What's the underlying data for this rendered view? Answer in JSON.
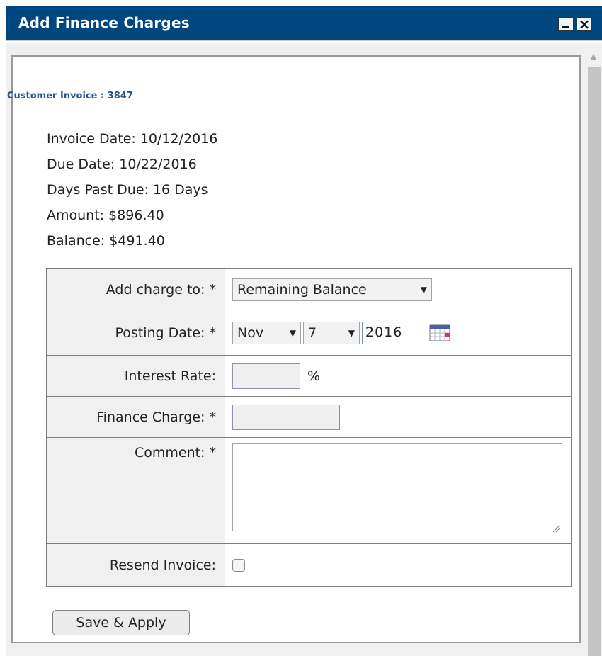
{
  "window": {
    "title": "Add Finance Charges"
  },
  "invoice": {
    "heading": "Customer Invoice : 3847",
    "invoice_date": "Invoice Date: 10/12/2016",
    "due_date": "Due Date: 10/22/2016",
    "days_past_due": "Days Past Due: 16 Days",
    "amount": "Amount: $896.40",
    "balance": "Balance: $491.40"
  },
  "form": {
    "add_charge_label": "Add charge to: *",
    "add_charge_value": "Remaining Balance",
    "posting_date_label": "Posting Date: *",
    "posting_month": "Nov",
    "posting_day": "7",
    "posting_year": "2016",
    "interest_rate_label": "Interest Rate:",
    "interest_rate_value": "",
    "interest_rate_unit": "%",
    "finance_charge_label": "Finance Charge: *",
    "finance_charge_value": "",
    "comment_label": "Comment: *",
    "comment_value": "",
    "resend_label": "Resend Invoice:",
    "resend_checked": false
  },
  "actions": {
    "save_apply_label": "Save & Apply"
  },
  "colors": {
    "titlebar": "#00477f",
    "heading": "#2a5589"
  },
  "icons": [
    "minimize-icon",
    "close-icon",
    "calendar-icon",
    "dropdown-arrow-icon",
    "resize-grip-icon",
    "scroll-up-icon"
  ]
}
